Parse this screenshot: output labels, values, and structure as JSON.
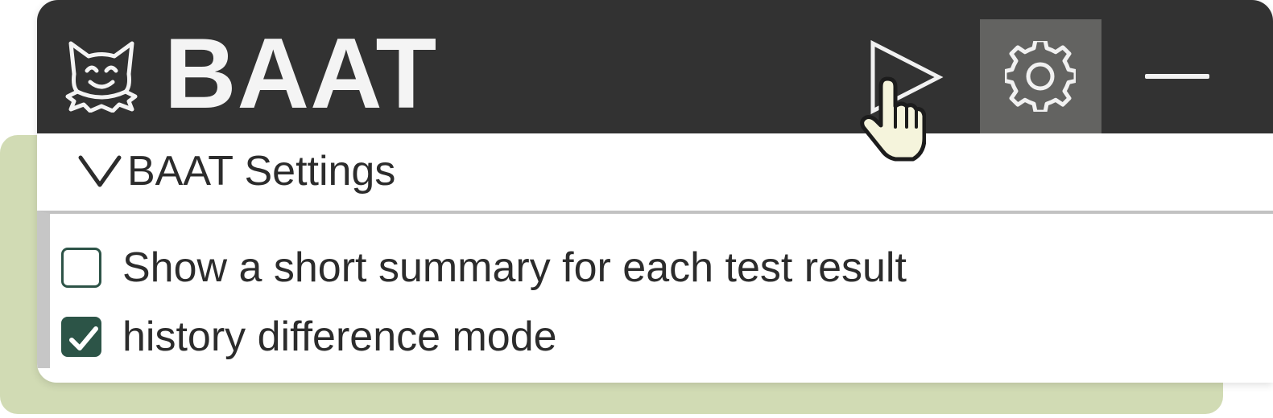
{
  "window": {
    "title": "BAAT",
    "logo_icon": "cat-mascot-icon"
  },
  "toolbar": {
    "run_icon": "play-icon",
    "settings_icon": "gear-icon",
    "minimize_icon": "minimize-icon"
  },
  "settings_section": {
    "title": "BAAT Settings",
    "expanded": true,
    "options": [
      {
        "label": "Show a short summary for each test result",
        "checked": false
      },
      {
        "label": "history difference mode",
        "checked": true
      }
    ]
  },
  "colors": {
    "titlebar": "#323232",
    "settings_active": "#636361",
    "backdrop": "#d1dbb4",
    "checkbox_accent": "#2c5447",
    "cursor_fill": "#f5f4dc"
  }
}
